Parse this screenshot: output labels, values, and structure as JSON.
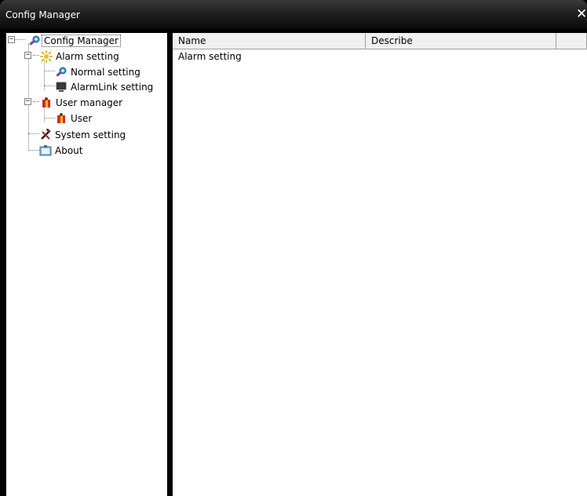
{
  "window": {
    "title": "Config Manager",
    "close_symbol": "✕"
  },
  "tree": {
    "collapse_symbol": "−",
    "nodes": [
      {
        "label": "Config Manager",
        "icon": "wrench-icon"
      },
      {
        "label": "Alarm setting",
        "icon": "alarm-icon"
      },
      {
        "label": "Normal setting",
        "icon": "wrench-icon"
      },
      {
        "label": "AlarmLink setting",
        "icon": "monitor-icon"
      },
      {
        "label": "User manager",
        "icon": "user-group-icon"
      },
      {
        "label": "User",
        "icon": "user-group-icon"
      },
      {
        "label": "System setting",
        "icon": "tools-icon"
      },
      {
        "label": "About",
        "icon": "about-icon"
      }
    ]
  },
  "list": {
    "columns": [
      "Name",
      "Describe",
      ""
    ],
    "rows": [
      {
        "name": "Alarm setting",
        "describe": ""
      }
    ]
  },
  "colors": {
    "titlebar": "#1a1a1a",
    "frame": "#000000",
    "pane": "#ffffff",
    "header": "#f0f0f0"
  }
}
